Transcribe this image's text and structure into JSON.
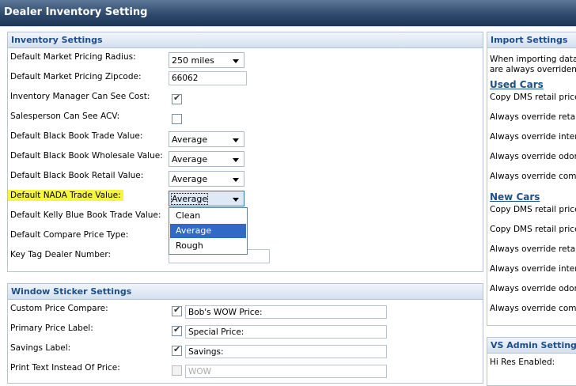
{
  "window": {
    "title": "Dealer Inventory Setting"
  },
  "inventory": {
    "header": "Inventory Settings",
    "radius_label": "Default Market Pricing Radius:",
    "radius_value": "250 miles",
    "zip_label": "Default Market Pricing Zipcode:",
    "zip_value": "66062",
    "mgr_cost_label": "Inventory Manager Can See Cost:",
    "acv_label": "Salesperson Can See ACV:",
    "bb_trade_label": "Default Black Book Trade Value:",
    "bb_trade_value": "Average",
    "bb_wholesale_label": "Default Black Book Wholesale Value:",
    "bb_wholesale_value": "Average",
    "bb_retail_label": "Default Black Book Retail Value:",
    "bb_retail_value": "Average",
    "nada_label": "Default NADA Trade Value:",
    "nada_value": "Average",
    "kbb_label": "Default Kelly Blue Book Trade Value:",
    "compare_label": "Default Compare Price Type:",
    "keytag_label": "Key Tag Dealer Number:"
  },
  "nada_dropdown": {
    "options": [
      "Clean",
      "Average",
      "Rough"
    ],
    "selected": "Average"
  },
  "sticker": {
    "header": "Window Sticker Settings",
    "custom_label": "Custom Price Compare:",
    "custom_value": "Bob's WOW Price:",
    "primary_label": "Primary Price Label:",
    "primary_value": "Special Price:",
    "savings_label": "Savings Label:",
    "savings_value": "Savings:",
    "print_label": "Print Text Instead Of Price:",
    "print_value": "WOW"
  },
  "import": {
    "header": "Import Settings",
    "intro1": "When importing data fr",
    "intro2": "are always overriden l",
    "used_title": "Used Cars",
    "used": [
      "Copy DMS retail price t",
      "Always override retail",
      "Always override interr",
      "Always override odom",
      "Always override comn"
    ],
    "new_title": "New Cars",
    "new": [
      "Copy DMS retail price t",
      "Copy DMS retail price t",
      "Always override retail",
      "Always override interr",
      "Always override odom",
      "Always override comn"
    ]
  },
  "vs_admin": {
    "header": "VS Admin Settings",
    "hires_label": "Hi Res Enabled:"
  }
}
